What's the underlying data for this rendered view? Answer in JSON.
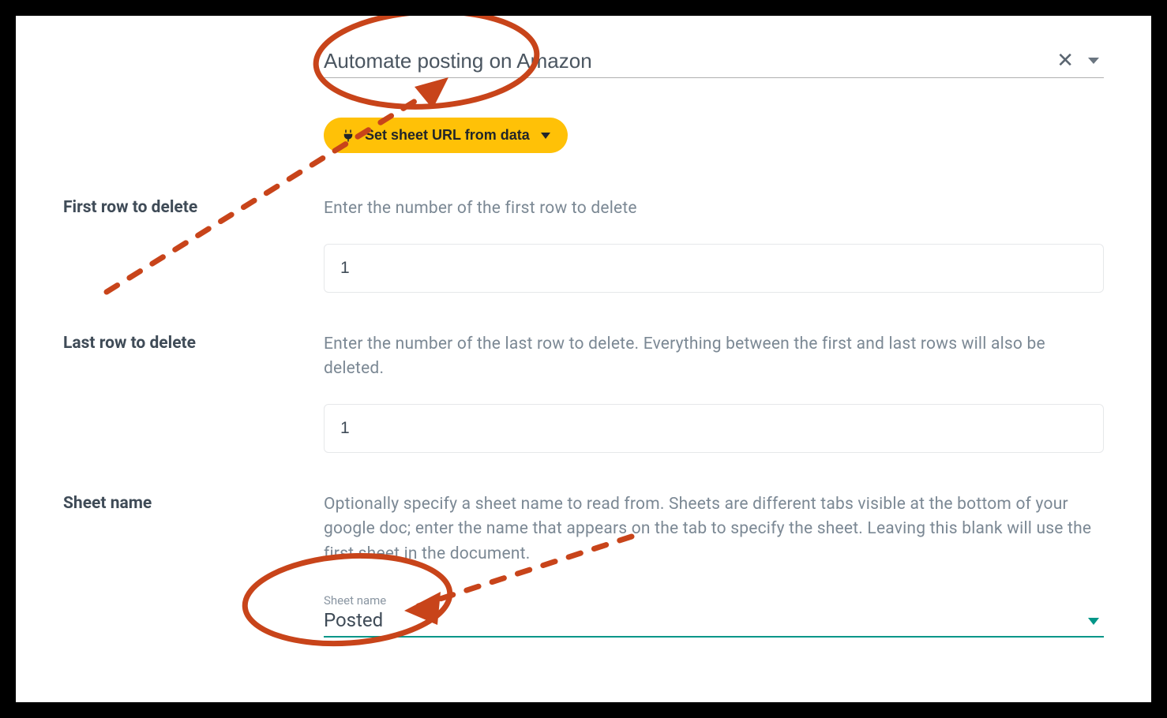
{
  "header": {
    "title": "Automate posting on Amazon"
  },
  "pill": {
    "label": "Set sheet URL from data"
  },
  "fields": {
    "first_row": {
      "label": "First row to delete",
      "desc": "Enter the number of the first row to delete",
      "value": "1"
    },
    "last_row": {
      "label": "Last row to delete",
      "desc": "Enter the number of the last row to delete. Everything between the first and last rows will also be deleted.",
      "value": "1"
    },
    "sheet_name": {
      "label": "Sheet name",
      "desc": "Optionally specify a sheet name to read from. Sheets are different tabs visible at the bottom of your google doc; enter the name that appears on the tab to specify the sheet. Leaving this blank will use the first sheet in the document.",
      "small_label": "Sheet name",
      "value": "Posted"
    }
  },
  "annotation": {
    "color": "#c8441a"
  }
}
